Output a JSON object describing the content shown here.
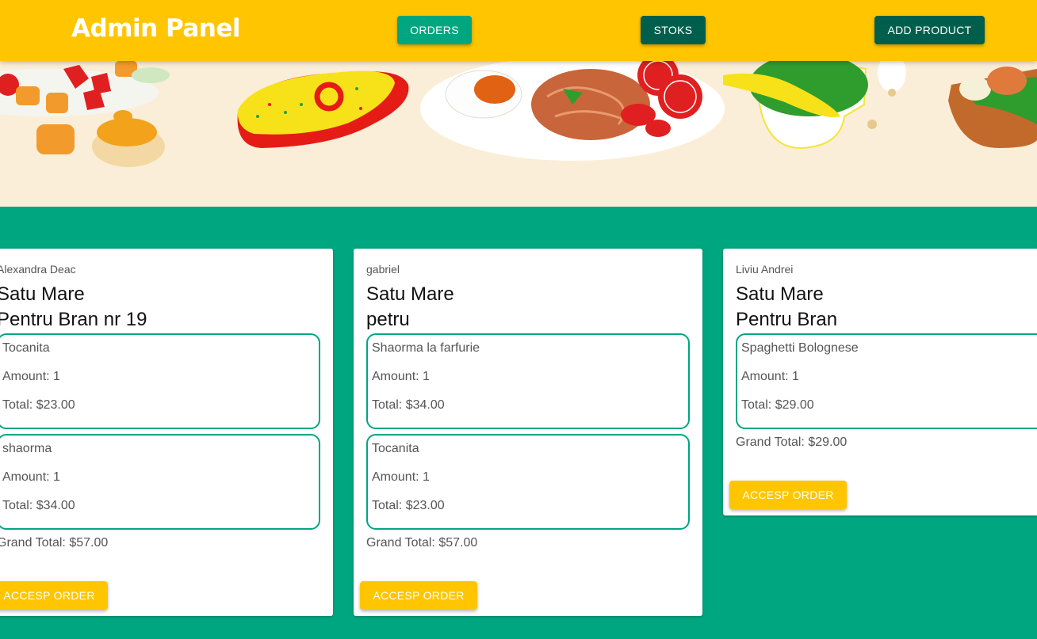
{
  "header": {
    "title": "Admin Panel",
    "orders_label": "ORDERS",
    "stoks_label": "STOKS",
    "add_product_label": "ADD PRODUCT"
  },
  "colors": {
    "accent_yellow": "#ffc600",
    "teal": "#00a680",
    "dark_teal": "#005f4c",
    "hero_bg": "#fbeed8"
  },
  "orders": [
    {
      "customer": "Alexandra Deac",
      "city": "Satu Mare",
      "street": "Pentru Bran nr 19",
      "items": [
        {
          "name": "Tocanita",
          "amount": "Amount: 1",
          "total": "Total: $23.00"
        },
        {
          "name": "shaorma",
          "amount": "Amount: 1",
          "total": "Total: $34.00"
        }
      ],
      "grand_total": "Grand Total: $57.00",
      "accept_label": "ACCESP ORDER"
    },
    {
      "customer": "gabriel",
      "city": "Satu Mare",
      "street": "petru",
      "items": [
        {
          "name": "Shaorma la farfurie",
          "amount": "Amount: 1",
          "total": "Total: $34.00"
        },
        {
          "name": "Tocanita",
          "amount": "Amount: 1",
          "total": "Total: $23.00"
        }
      ],
      "grand_total": "Grand Total: $57.00",
      "accept_label": "ACCESP ORDER"
    },
    {
      "customer": "Liviu Andrei",
      "city": "Satu Mare",
      "street": "Pentru Bran",
      "items": [
        {
          "name": "Spaghetti Bolognese",
          "amount": "Amount: 1",
          "total": "Total: $29.00"
        }
      ],
      "grand_total": "Grand Total: $29.00",
      "accept_label": "ACCESP ORDER"
    }
  ]
}
